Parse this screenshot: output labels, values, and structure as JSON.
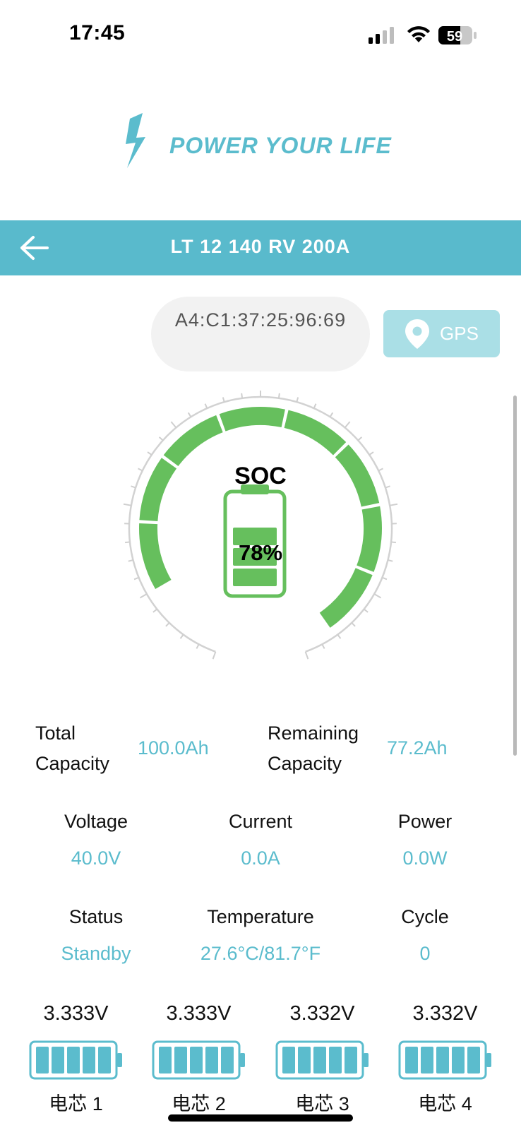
{
  "status_bar": {
    "time": "17:45",
    "battery_level": "59"
  },
  "logo": {
    "tagline": "POWER YOUR LIFE"
  },
  "header": {
    "title": "LT 12 140 RV 200A"
  },
  "device": {
    "address": "A4:C1:37:25:96:69",
    "gps_label": "GPS"
  },
  "soc": {
    "label": "SOC",
    "percent_text": "78%",
    "percent": 78
  },
  "capacity": {
    "total_label_1": "Total",
    "total_label_2": "Capacity",
    "total_value": "100.0Ah",
    "remaining_label_1": "Remaining",
    "remaining_label_2": "Capacity",
    "remaining_value": "77.2Ah"
  },
  "metrics": [
    {
      "label": "Voltage",
      "value": "40.0V"
    },
    {
      "label": "Current",
      "value": "0.0A"
    },
    {
      "label": "Power",
      "value": "0.0W"
    },
    {
      "label": "Status",
      "value": "Standby"
    },
    {
      "label": "Temperature",
      "value": "27.6°C/81.7°F"
    },
    {
      "label": "Cycle",
      "value": "0"
    }
  ],
  "cells": [
    {
      "voltage": "3.333V",
      "name": "电芯 1"
    },
    {
      "voltage": "3.333V",
      "name": "电芯 2"
    },
    {
      "voltage": "3.332V",
      "name": "电芯 3"
    },
    {
      "voltage": "3.332V",
      "name": "电芯 4"
    }
  ],
  "colors": {
    "accent": "#59bacc",
    "gauge_green": "#66bf5d",
    "value_blue": "#5bbccd",
    "gps_bg": "#aadfe6"
  }
}
